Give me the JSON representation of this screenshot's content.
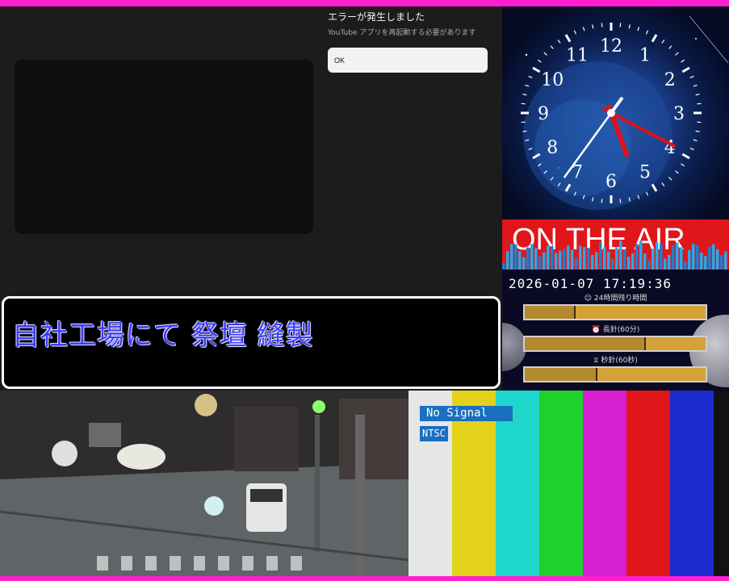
{
  "youtube_error": {
    "title": "エラーが発生しました",
    "message": "YouTube アプリを再起動する必要があります",
    "ok_label": "OK"
  },
  "caption": {
    "text": "自社工場にて 祭壇 縫製"
  },
  "clock": {
    "numbers": [
      "12",
      "1",
      "2",
      "3",
      "4",
      "5",
      "6",
      "7",
      "8",
      "9",
      "10",
      "11"
    ],
    "hour": 17,
    "minute": 19,
    "second": 36
  },
  "on_air": {
    "banner": "ON THE AIR",
    "datetime": "2026-01-07 17:19:36",
    "gauges": [
      {
        "label": "☺ 24時間残り時間",
        "fraction": 0.28
      },
      {
        "label": "⏰ 長針(60分)",
        "fraction": 0.67
      },
      {
        "label": "⧖ 秒針(60秒)",
        "fraction": 0.4
      }
    ]
  },
  "test_pattern": {
    "no_signal": "No Signal",
    "standard": "NTSC",
    "bar_colors": [
      "#e6e6e6",
      "#e3d21a",
      "#1fd6cc",
      "#1fd12a",
      "#d61fd0",
      "#e0161a",
      "#1a2cd0",
      "#121212"
    ]
  },
  "colors": {
    "frame": "#ff1fd0",
    "caption_text": "#3b3bff",
    "air_banner": "#e0161a"
  }
}
